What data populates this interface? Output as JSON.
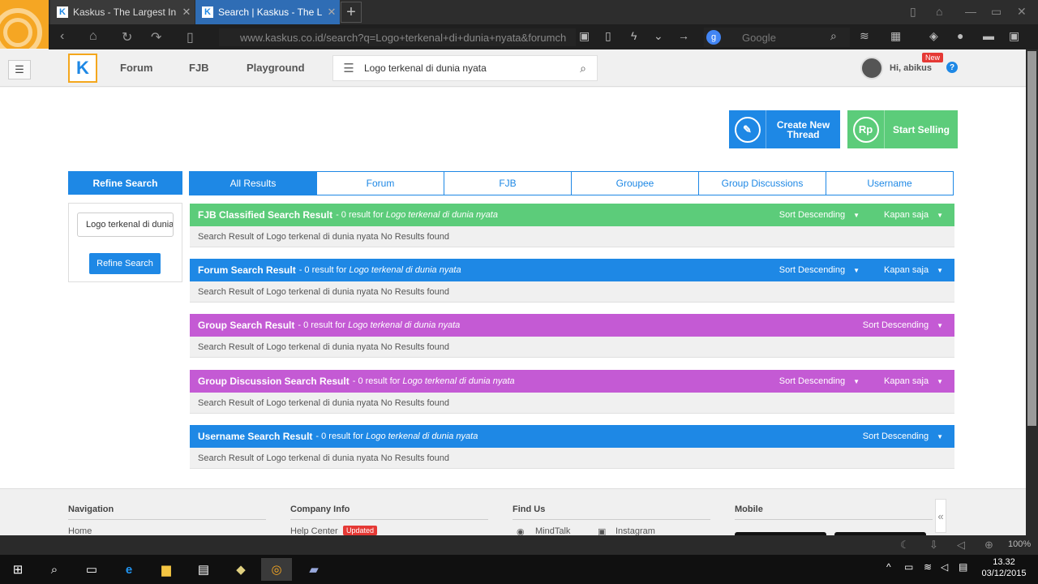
{
  "browser": {
    "tabs": [
      {
        "title": "Kaskus - The Largest In"
      },
      {
        "title": "Search | Kaskus - The L"
      }
    ],
    "url": "www.kaskus.co.id/search?q=Logo+terkenal+di+dunia+nyata&forumch",
    "search_placeholder": "Google",
    "zoom": "100%"
  },
  "header": {
    "logo": "K",
    "nav": [
      "Forum",
      "FJB",
      "Playground"
    ],
    "search_value": "Logo terkenal di dunia nyata",
    "greeting": "Hi, abikus",
    "new_badge": "New",
    "help": "?"
  },
  "cta": {
    "create_thread": "Create New Thread",
    "start_selling": "Start Selling",
    "rp": "Rp"
  },
  "refine": {
    "title": "Refine Search",
    "input_value": "Logo terkenal di dunia nyata",
    "button": "Refine Search"
  },
  "tabs": [
    "All Results",
    "Forum",
    "FJB",
    "Groupee",
    "Group Discussions",
    "Username"
  ],
  "results": [
    {
      "title": "FJB Classified Search Result",
      "count": "- 0 result for",
      "query": "Logo terkenal di dunia nyata",
      "sort": "Sort Descending",
      "time": "Kapan saja",
      "body": "Search Result of Logo terkenal di dunia nyata No Results found"
    },
    {
      "title": "Forum Search Result",
      "count": "- 0 result for",
      "query": "Logo terkenal di dunia nyata",
      "sort": "Sort Descending",
      "time": "Kapan saja",
      "body": "Search Result of Logo terkenal di dunia nyata No Results found"
    },
    {
      "title": "Group Search Result",
      "count": "- 0 result for",
      "query": "Logo terkenal di dunia nyata",
      "sort": "Sort Descending",
      "body": "Search Result of Logo terkenal di dunia nyata No Results found"
    },
    {
      "title": "Group Discussion Search Result",
      "count": "- 0 result for",
      "query": "Logo terkenal di dunia nyata",
      "sort": "Sort Descending",
      "time": "Kapan saja",
      "body": "Search Result of Logo terkenal di dunia nyata No Results found"
    },
    {
      "title": "Username Search Result",
      "count": "- 0 result for",
      "query": "Logo terkenal di dunia nyata",
      "sort": "Sort Descending",
      "body": "Search Result of Logo terkenal di dunia nyata No Results found"
    }
  ],
  "footer": {
    "navigation": "Navigation",
    "company": "Company Info",
    "findus": "Find Us",
    "mobile": "Mobile",
    "home": "Home",
    "help_center": "Help Center",
    "updated": "Updated",
    "mindtalk": "MindTalk",
    "instagram": "Instagram"
  },
  "taskbar": {
    "time": "13.32",
    "date": "03/12/2015"
  },
  "colors": {
    "kaskus_blue": "#1e88e5",
    "fjb_green": "#5ccc7a",
    "group_purple": "#c45ad4",
    "logo_orange": "#f4a71d"
  }
}
